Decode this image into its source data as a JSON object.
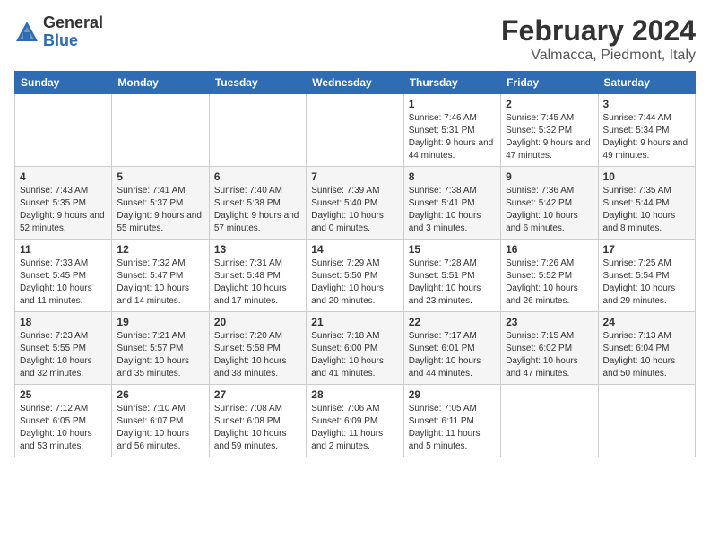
{
  "logo": {
    "general": "General",
    "blue": "Blue"
  },
  "title": "February 2024",
  "location": "Valmacca, Piedmont, Italy",
  "weekdays": [
    "Sunday",
    "Monday",
    "Tuesday",
    "Wednesday",
    "Thursday",
    "Friday",
    "Saturday"
  ],
  "weeks": [
    [
      {
        "day": "",
        "info": ""
      },
      {
        "day": "",
        "info": ""
      },
      {
        "day": "",
        "info": ""
      },
      {
        "day": "",
        "info": ""
      },
      {
        "day": "1",
        "info": "Sunrise: 7:46 AM\nSunset: 5:31 PM\nDaylight: 9 hours\nand 44 minutes."
      },
      {
        "day": "2",
        "info": "Sunrise: 7:45 AM\nSunset: 5:32 PM\nDaylight: 9 hours\nand 47 minutes."
      },
      {
        "day": "3",
        "info": "Sunrise: 7:44 AM\nSunset: 5:34 PM\nDaylight: 9 hours\nand 49 minutes."
      }
    ],
    [
      {
        "day": "4",
        "info": "Sunrise: 7:43 AM\nSunset: 5:35 PM\nDaylight: 9 hours\nand 52 minutes."
      },
      {
        "day": "5",
        "info": "Sunrise: 7:41 AM\nSunset: 5:37 PM\nDaylight: 9 hours\nand 55 minutes."
      },
      {
        "day": "6",
        "info": "Sunrise: 7:40 AM\nSunset: 5:38 PM\nDaylight: 9 hours\nand 57 minutes."
      },
      {
        "day": "7",
        "info": "Sunrise: 7:39 AM\nSunset: 5:40 PM\nDaylight: 10 hours\nand 0 minutes."
      },
      {
        "day": "8",
        "info": "Sunrise: 7:38 AM\nSunset: 5:41 PM\nDaylight: 10 hours\nand 3 minutes."
      },
      {
        "day": "9",
        "info": "Sunrise: 7:36 AM\nSunset: 5:42 PM\nDaylight: 10 hours\nand 6 minutes."
      },
      {
        "day": "10",
        "info": "Sunrise: 7:35 AM\nSunset: 5:44 PM\nDaylight: 10 hours\nand 8 minutes."
      }
    ],
    [
      {
        "day": "11",
        "info": "Sunrise: 7:33 AM\nSunset: 5:45 PM\nDaylight: 10 hours\nand 11 minutes."
      },
      {
        "day": "12",
        "info": "Sunrise: 7:32 AM\nSunset: 5:47 PM\nDaylight: 10 hours\nand 14 minutes."
      },
      {
        "day": "13",
        "info": "Sunrise: 7:31 AM\nSunset: 5:48 PM\nDaylight: 10 hours\nand 17 minutes."
      },
      {
        "day": "14",
        "info": "Sunrise: 7:29 AM\nSunset: 5:50 PM\nDaylight: 10 hours\nand 20 minutes."
      },
      {
        "day": "15",
        "info": "Sunrise: 7:28 AM\nSunset: 5:51 PM\nDaylight: 10 hours\nand 23 minutes."
      },
      {
        "day": "16",
        "info": "Sunrise: 7:26 AM\nSunset: 5:52 PM\nDaylight: 10 hours\nand 26 minutes."
      },
      {
        "day": "17",
        "info": "Sunrise: 7:25 AM\nSunset: 5:54 PM\nDaylight: 10 hours\nand 29 minutes."
      }
    ],
    [
      {
        "day": "18",
        "info": "Sunrise: 7:23 AM\nSunset: 5:55 PM\nDaylight: 10 hours\nand 32 minutes."
      },
      {
        "day": "19",
        "info": "Sunrise: 7:21 AM\nSunset: 5:57 PM\nDaylight: 10 hours\nand 35 minutes."
      },
      {
        "day": "20",
        "info": "Sunrise: 7:20 AM\nSunset: 5:58 PM\nDaylight: 10 hours\nand 38 minutes."
      },
      {
        "day": "21",
        "info": "Sunrise: 7:18 AM\nSunset: 6:00 PM\nDaylight: 10 hours\nand 41 minutes."
      },
      {
        "day": "22",
        "info": "Sunrise: 7:17 AM\nSunset: 6:01 PM\nDaylight: 10 hours\nand 44 minutes."
      },
      {
        "day": "23",
        "info": "Sunrise: 7:15 AM\nSunset: 6:02 PM\nDaylight: 10 hours\nand 47 minutes."
      },
      {
        "day": "24",
        "info": "Sunrise: 7:13 AM\nSunset: 6:04 PM\nDaylight: 10 hours\nand 50 minutes."
      }
    ],
    [
      {
        "day": "25",
        "info": "Sunrise: 7:12 AM\nSunset: 6:05 PM\nDaylight: 10 hours\nand 53 minutes."
      },
      {
        "day": "26",
        "info": "Sunrise: 7:10 AM\nSunset: 6:07 PM\nDaylight: 10 hours\nand 56 minutes."
      },
      {
        "day": "27",
        "info": "Sunrise: 7:08 AM\nSunset: 6:08 PM\nDaylight: 10 hours\nand 59 minutes."
      },
      {
        "day": "28",
        "info": "Sunrise: 7:06 AM\nSunset: 6:09 PM\nDaylight: 11 hours\nand 2 minutes."
      },
      {
        "day": "29",
        "info": "Sunrise: 7:05 AM\nSunset: 6:11 PM\nDaylight: 11 hours\nand 5 minutes."
      },
      {
        "day": "",
        "info": ""
      },
      {
        "day": "",
        "info": ""
      }
    ]
  ]
}
